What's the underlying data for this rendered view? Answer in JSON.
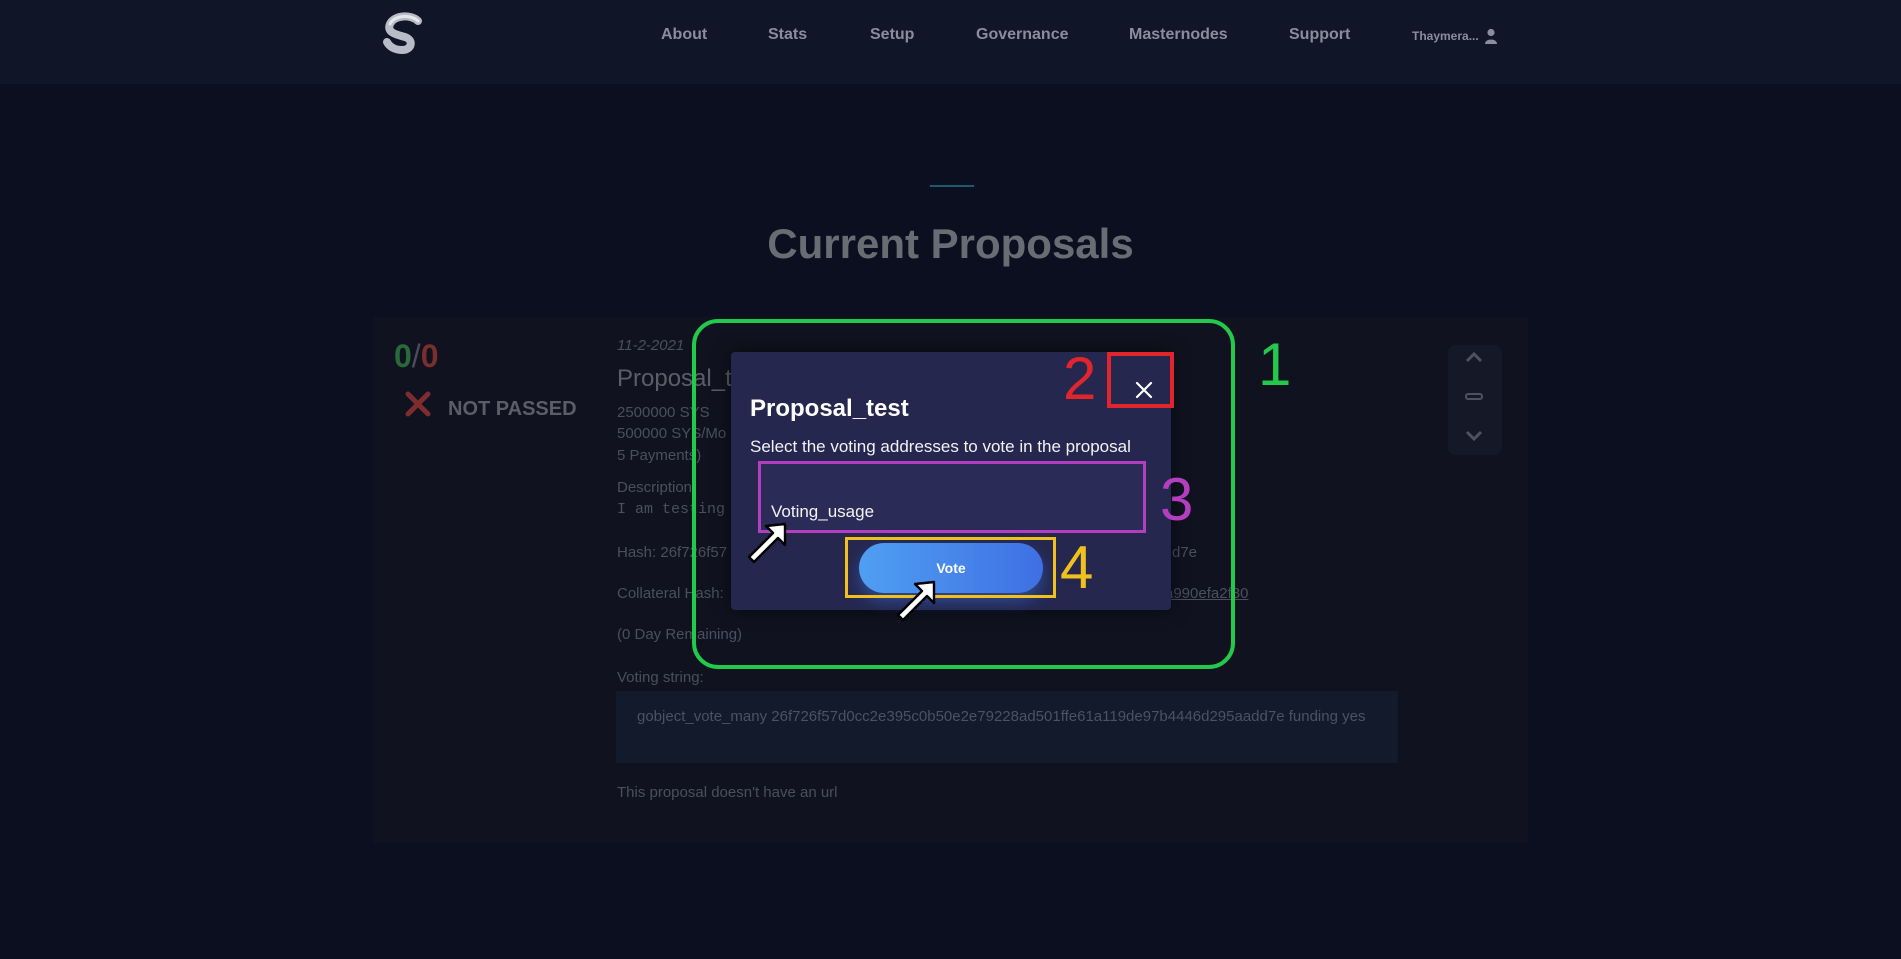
{
  "navbar": {
    "logo_icon": "syscoin-logo-icon",
    "links": [
      {
        "label": "About"
      },
      {
        "label": "Stats"
      },
      {
        "label": "Setup"
      },
      {
        "label": "Governance"
      },
      {
        "label": "Masternodes"
      },
      {
        "label": "Support"
      }
    ],
    "user": {
      "label": "Thaymera...",
      "icon": "user-icon"
    }
  },
  "hero": {
    "title": "Current Proposals"
  },
  "proposal": {
    "votes_yes": "0",
    "votes_separator": "/",
    "votes_no": "0",
    "status": "NOT PASSED",
    "status_icon": "x-icon",
    "date": "11-2-2021",
    "name": "Proposal_te",
    "amount_total": "2500000 SYS",
    "amount_monthly": "500000 SYS/Mo",
    "payments": "5 Payments)",
    "description_label": "Description:",
    "description_text": "I am testing",
    "hash_label": "Hash: 26f726f57",
    "hash_tail": "d7e",
    "collateral_label": "Collateral Hash:",
    "collateral_tail": "a990efa2f80",
    "remaining": "(0 Day Remaining)",
    "voting_string_label": "Voting string:",
    "voting_string": "gobject_vote_many 26f726f57d0cc2e395c0b50e2e79228ad501ffe61a119de97b4446d295aadd7e funding yes",
    "url_note": "This proposal doesn't have an url",
    "side_controls": [
      "chevron-up-icon",
      "minus-icon",
      "chevron-down-icon"
    ]
  },
  "modal": {
    "title": "Proposal_test",
    "description": "Select the voting addresses to vote in the proposal",
    "addresses": [
      "Voting_usage"
    ],
    "vote_button": "Vote",
    "close_icon": "close-icon"
  },
  "annotations": [
    {
      "number": "1",
      "color": "#22c94a",
      "target": "modal"
    },
    {
      "number": "2",
      "color": "#e0262c",
      "target": "close-button"
    },
    {
      "number": "3",
      "color": "#b43ec0",
      "target": "address-list"
    },
    {
      "number": "4",
      "color": "#f0c11e",
      "target": "vote-button"
    }
  ]
}
